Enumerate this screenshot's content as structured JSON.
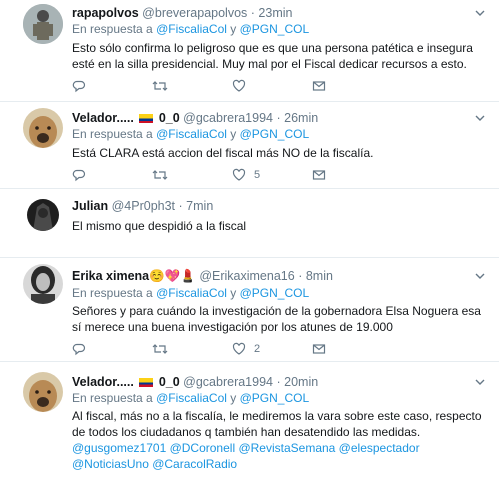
{
  "tweets": [
    {
      "name": "rapapolvos",
      "handle": "@breverapapolvos",
      "time": "23min",
      "reply_prefix": "En respuesta a",
      "reply_to_1": "@FiscaliaCol",
      "reply_and": "y",
      "reply_to_2": "@PGN_COL",
      "body_1": "Esto sólo confirma lo peligroso que es que una persona patética e insegura",
      "body_2": "esté en la silla presidencial. Muy mal por el Fiscal dedicar recursos a esto."
    },
    {
      "name": "Velador.....",
      "name_suffix": "0_0",
      "handle": "@gcabrera1994",
      "time": "26min",
      "reply_prefix": "En respuesta a",
      "reply_to_1": "@FiscaliaCol",
      "reply_and": "y",
      "reply_to_2": "@PGN_COL",
      "body_1": "Está CLARA está accion del fiscal más NO de la fiscalía.",
      "like_count": "5"
    },
    {
      "name": "Julian",
      "handle": "@4Pr0ph3t",
      "time": "7min",
      "body_1": "El mismo que despidió a la fiscal"
    },
    {
      "name": "Erika ximena",
      "handle": "@Erikaximena16",
      "time": "8min",
      "emoji": "☺️💖💄",
      "reply_prefix": "En respuesta a",
      "reply_to_1": "@FiscaliaCol",
      "reply_and": "y",
      "reply_to_2": "@PGN_COL",
      "body_1": "Señores y para cuándo la investigación de la gobernadora Elsa Noguera esa",
      "body_2": "sí merece una buena investigación por los atunes de 19.000",
      "like_count": "2"
    },
    {
      "name": "Velador.....",
      "name_suffix": "0_0",
      "handle": "@gcabrera1994",
      "time": "20min",
      "reply_prefix": "En respuesta a",
      "reply_to_1": "@FiscaliaCol",
      "reply_and": "y",
      "reply_to_2": "@PGN_COL",
      "body_1": "Al fiscal, más no a la fiscalía, le mediremos la vara sobre este caso, respecto",
      "body_2": "de todos los ciudadanos q también han desatendido las medidas.",
      "mentions_1": "@gusgomez1701 @DCoronell @RevistaSemana @elespectador",
      "mentions_2": "@NoticiasUno @CaracolRadio"
    }
  ],
  "separator_dot": "·",
  "icons": [
    "reply-icon",
    "retweet-icon",
    "like-icon",
    "dm-icon",
    "chevron-down-icon",
    "flag-icon"
  ],
  "colors": {
    "link": "#1b95e0",
    "muted": "#657786",
    "text": "#14171a",
    "border": "#e6ecf0"
  }
}
